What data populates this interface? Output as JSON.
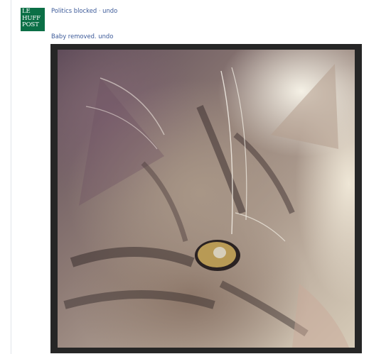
{
  "logo": {
    "lines": [
      "LE",
      "HUFF",
      "POST"
    ]
  },
  "notices": [
    {
      "text": "Politics blocked",
      "sep": " · ",
      "action": "undo"
    },
    {
      "text": "Baby removed.",
      "sep": " ",
      "action": "undo"
    }
  ],
  "photo": {
    "subject": "tabby kitten close-up"
  },
  "colors": {
    "brand": "#0b6f46",
    "link": "#3b5998",
    "frame": "#262626"
  }
}
